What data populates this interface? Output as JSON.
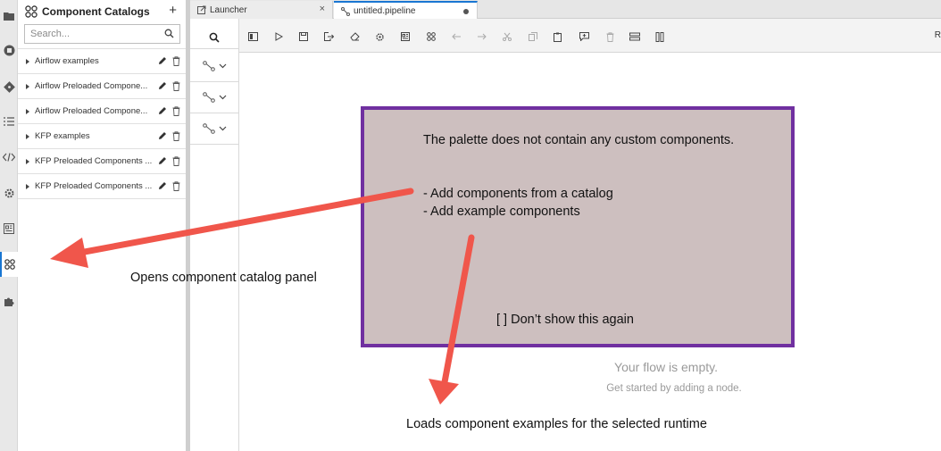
{
  "sidebar": {
    "title": "Component Catalogs",
    "add_symbol": "+",
    "search_placeholder": "Search...",
    "items": [
      {
        "label": "Airflow examples"
      },
      {
        "label": "Airflow Preloaded Compone..."
      },
      {
        "label": "Airflow Preloaded Compone..."
      },
      {
        "label": "KFP examples"
      },
      {
        "label": "KFP Preloaded Components ..."
      },
      {
        "label": "KFP Preloaded Components ..."
      }
    ]
  },
  "tabs": [
    {
      "label": "Launcher",
      "close": "×"
    },
    {
      "label": "untitled.pipeline"
    }
  ],
  "toolbar": {
    "overflow_label": "R"
  },
  "canvas": {
    "empty_title": "Your flow is empty.",
    "empty_subtitle": "Get started by adding a node."
  },
  "callout": {
    "line1": "The palette does not contain any custom components.",
    "line2": "- Add components from a catalog",
    "line3": "- Add example components",
    "line4": "[ ] Don’t show this again"
  },
  "annotations": {
    "catalog_panel": "Opens component catalog panel",
    "examples": "Loads component examples for the selected runtime"
  },
  "colors": {
    "callout_fill": "#cdbfbf",
    "callout_border": "#7030a0",
    "arrow": "#f0564b",
    "accent": "#1976d2"
  }
}
